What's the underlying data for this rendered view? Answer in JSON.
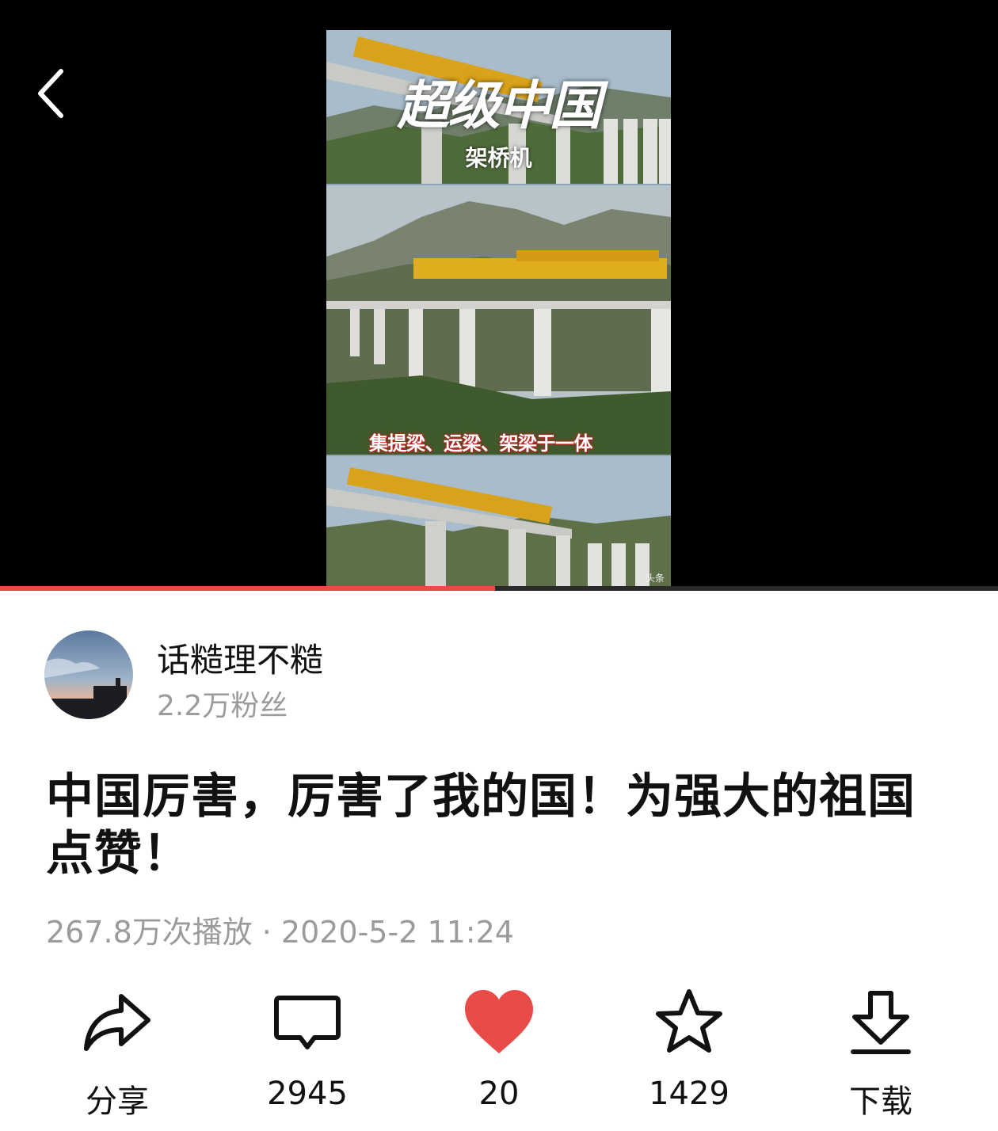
{
  "video": {
    "overlay_title": "超级中国",
    "overlay_subtitle": "架桥机",
    "overlay_caption": "集提梁、运梁、架梁于一体",
    "watermark": "头条",
    "progress": 0.496
  },
  "author": {
    "name": "话糙理不糙",
    "fans": "2.2万粉丝"
  },
  "post": {
    "title": "中国厉害，厉害了我的国！为强大的祖国点赞！",
    "plays": "267.8万次播放",
    "separator": "·",
    "datetime": "2020-5-2 11:24"
  },
  "actions": {
    "share": {
      "label": "分享",
      "icon": "share-arrow-icon"
    },
    "comment": {
      "label": "2945",
      "icon": "comment-bubble-icon"
    },
    "like": {
      "label": "20",
      "icon": "heart-icon",
      "active": true
    },
    "favorite": {
      "label": "1429",
      "icon": "star-icon"
    },
    "download": {
      "label": "下载",
      "icon": "download-icon"
    }
  },
  "colors": {
    "accent": "#e84b48",
    "muted_text": "#9b9b9b",
    "player_bg": "#000000"
  }
}
